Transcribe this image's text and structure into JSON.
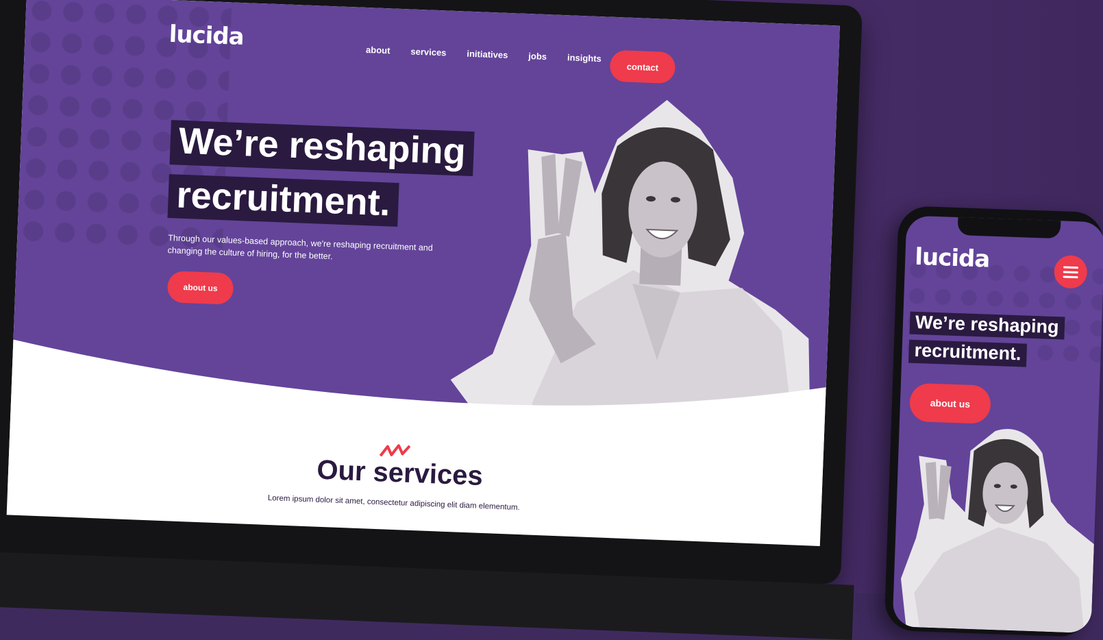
{
  "brand": {
    "name": "lucida",
    "colors": {
      "primary": "#634499",
      "accent": "#ef3b4b",
      "dark": "#2a1a40"
    }
  },
  "nav": {
    "items": [
      "about",
      "services",
      "initiatives",
      "jobs",
      "insights"
    ],
    "cta": "contact"
  },
  "hero": {
    "headline_line1": "We’re reshaping",
    "headline_line2": "recruitment.",
    "subtext": "Through our values-based approach, we're reshaping recruitment and changing the culture of hiring, for the better.",
    "button": "about us"
  },
  "services": {
    "title": "Our services",
    "text": "Lorem ipsum dolor sit amet, consectetur adipiscing elit  diam elementum."
  },
  "mobile": {
    "logo": "lucida",
    "menu_icon": "hamburger-menu-icon",
    "headline_line1": "We’re reshaping",
    "headline_line2": "recruitment.",
    "button": "about us"
  }
}
